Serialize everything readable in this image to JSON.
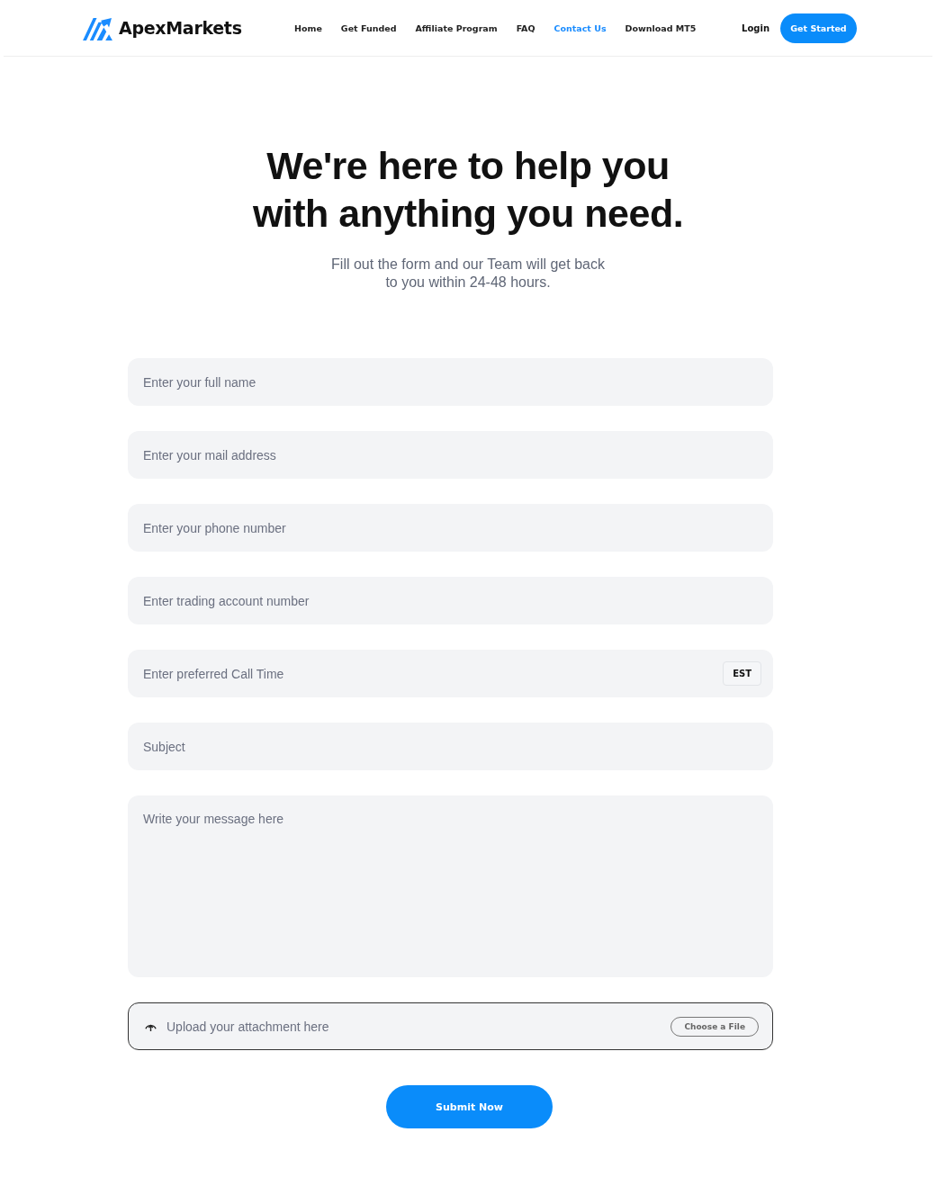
{
  "brand": {
    "name": "ApexMarkets"
  },
  "nav": [
    {
      "label": "Home",
      "selected": false
    },
    {
      "label": "Get Funded",
      "selected": false
    },
    {
      "label": "Affiliate Program",
      "selected": false
    },
    {
      "label": "FAQ",
      "selected": false
    },
    {
      "label": "Contact Us",
      "selected": true
    },
    {
      "label": "Download MT5",
      "selected": false
    }
  ],
  "login": "Login",
  "cta": "Get Started",
  "heading": "We're here to help you with anything you need.",
  "subheading": "Fill out the form and our Team will get back to you within 24-48 hours.",
  "fields": [
    {
      "kind": "text",
      "placeholder": "Enter your full name"
    },
    {
      "kind": "text",
      "placeholder": "Enter your mail address"
    },
    {
      "kind": "text",
      "placeholder": "Enter your phone number"
    },
    {
      "kind": "text",
      "placeholder": "Enter trading account number"
    },
    {
      "kind": "time",
      "placeholder": "Enter preferred Call Time",
      "suffix": "EST"
    },
    {
      "kind": "text",
      "placeholder": "Subject"
    },
    {
      "kind": "textarea",
      "placeholder": "Write your message here"
    }
  ],
  "upload": {
    "label": "Upload your attachment here",
    "button": "Choose a File"
  },
  "submit": "Submit Now"
}
